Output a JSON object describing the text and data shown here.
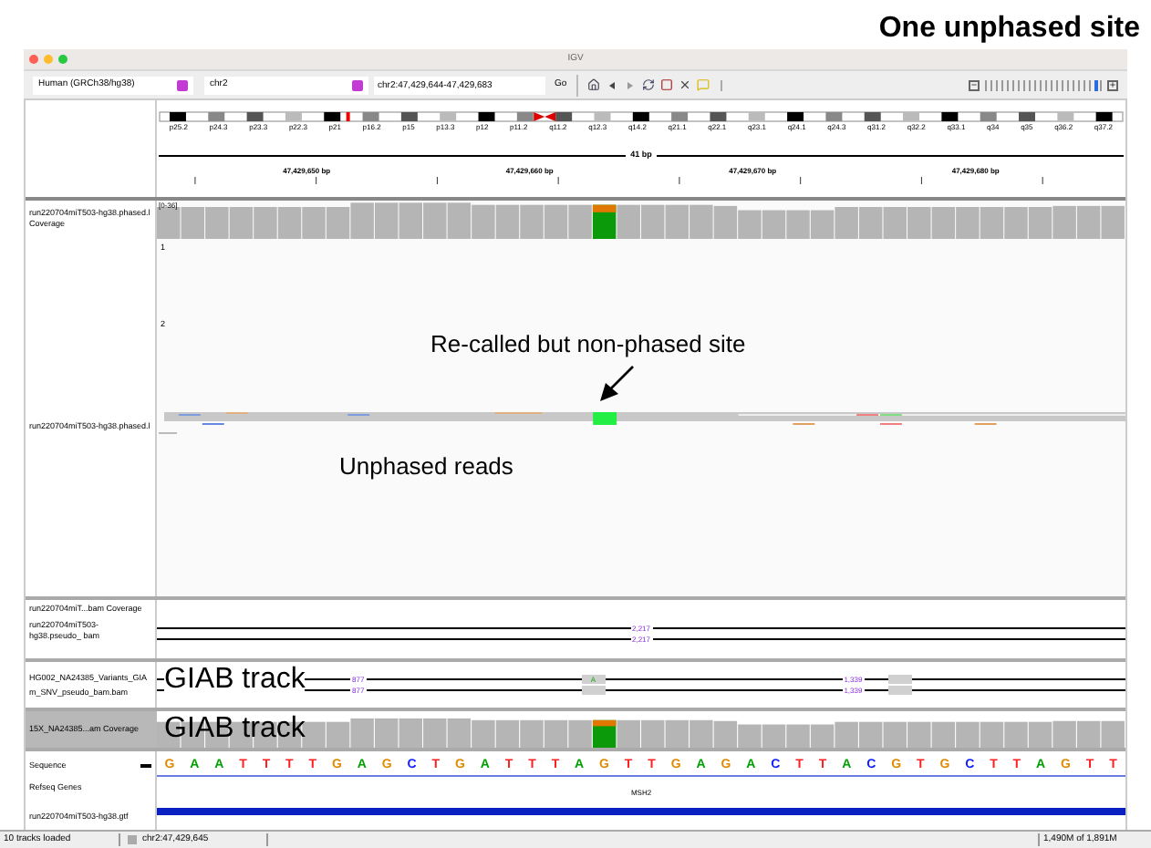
{
  "headline": "One unphased site",
  "window": {
    "title": "IGV"
  },
  "toolbar": {
    "genome": "Human (GRCh38/hg38)",
    "chromosome": "chr2",
    "locus": "chr2:47,429,644-47,429,683",
    "go": "Go",
    "zoom": {
      "level": 0.95
    }
  },
  "ideogram": {
    "bands": [
      "p25.2",
      "p24.3",
      "p23.3",
      "p22.3",
      "p21",
      "p16.2",
      "p15",
      "p13.3",
      "p12",
      "p11.2",
      "q11.2",
      "q12.3",
      "q14.2",
      "q21.1",
      "q22.1",
      "q23.1",
      "q24.1",
      "q24.3",
      "q31.2",
      "q32.2",
      "q33.1",
      "q34",
      "q35",
      "q36.2",
      "q37.2"
    ]
  },
  "ruler": {
    "span": "41 bp",
    "ticks": [
      "47,429,650 bp",
      "47,429,660 bp",
      "47,429,670 bp",
      "47,429,680 bp"
    ]
  },
  "alignment_panel": {
    "coverage_label": "run220704miT503-hg38.phased.l Coverage",
    "range": "[0-36]",
    "rows": [
      "1",
      "2"
    ],
    "reads_label": "run220704miT503-hg38.phased.l",
    "arrow_label": "Re-called but non-phased site",
    "reads_note": "Unphased reads"
  },
  "pseudo_panel": {
    "coverage_label": "run220704miT...bam Coverage",
    "track_label": "run220704miT503-hg38.pseudo_ bam",
    "counts": [
      "2,217",
      "2,217"
    ]
  },
  "giab_panel": {
    "label_lines": [
      "HG002_NA24385_Variants_GIA",
      "m_SNV_pseudo_bam.bam"
    ],
    "left_counts": [
      "877",
      "877"
    ],
    "right_counts": [
      "1,339",
      "1,339"
    ],
    "variant": "A",
    "overlay": "GIAB track"
  },
  "giab_coverage": {
    "label": "15X_NA24385...am Coverage",
    "overlay": "GIAB track"
  },
  "features": {
    "sequence_label": "Sequence",
    "genes_label": "Refseq Genes",
    "gene": "MSH2",
    "gtf_label": "run220704miT503-hg38.gtf",
    "sequence": [
      {
        "base": "G",
        "color": "#e08a00"
      },
      {
        "base": "A",
        "color": "#00a000"
      },
      {
        "base": "A",
        "color": "#00a000"
      },
      {
        "base": "T",
        "color": "#ff2020"
      },
      {
        "base": "T",
        "color": "#ff2020"
      },
      {
        "base": "T",
        "color": "#ff2020"
      },
      {
        "base": "T",
        "color": "#ff2020"
      },
      {
        "base": "G",
        "color": "#e08a00"
      },
      {
        "base": "A",
        "color": "#00a000"
      },
      {
        "base": "G",
        "color": "#e08a00"
      },
      {
        "base": "C",
        "color": "#1020ff"
      },
      {
        "base": "T",
        "color": "#ff2020"
      },
      {
        "base": "G",
        "color": "#e08a00"
      },
      {
        "base": "A",
        "color": "#00a000"
      },
      {
        "base": "T",
        "color": "#ff2020"
      },
      {
        "base": "T",
        "color": "#ff2020"
      },
      {
        "base": "T",
        "color": "#ff2020"
      },
      {
        "base": "A",
        "color": "#00a000"
      },
      {
        "base": "G",
        "color": "#e08a00"
      },
      {
        "base": "T",
        "color": "#ff2020"
      },
      {
        "base": "T",
        "color": "#ff2020"
      },
      {
        "base": "G",
        "color": "#e08a00"
      },
      {
        "base": "A",
        "color": "#00a000"
      },
      {
        "base": "G",
        "color": "#e08a00"
      },
      {
        "base": "A",
        "color": "#00a000"
      },
      {
        "base": "C",
        "color": "#1020ff"
      },
      {
        "base": "T",
        "color": "#ff2020"
      },
      {
        "base": "T",
        "color": "#ff2020"
      },
      {
        "base": "A",
        "color": "#00a000"
      },
      {
        "base": "C",
        "color": "#1020ff"
      },
      {
        "base": "G",
        "color": "#e08a00"
      },
      {
        "base": "T",
        "color": "#ff2020"
      },
      {
        "base": "G",
        "color": "#e08a00"
      },
      {
        "base": "C",
        "color": "#1020ff"
      },
      {
        "base": "T",
        "color": "#ff2020"
      },
      {
        "base": "T",
        "color": "#ff2020"
      },
      {
        "base": "A",
        "color": "#00a000"
      },
      {
        "base": "G",
        "color": "#e08a00"
      },
      {
        "base": "T",
        "color": "#ff2020"
      },
      {
        "base": "T",
        "color": "#ff2020"
      }
    ]
  },
  "status_bar": {
    "tracks": "10 tracks loaded",
    "position": "chr2:47,429,645",
    "memory": "1,490M of 1,891M"
  }
}
